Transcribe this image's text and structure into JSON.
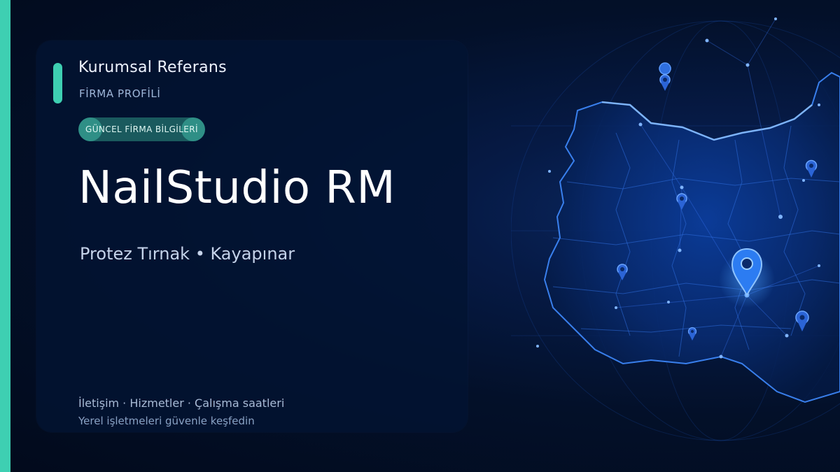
{
  "header": {
    "kicker": "Kurumsal Referans",
    "subkicker": "FİRMA PROFİLİ",
    "badge": "GÜNCEL FİRMA BİLGİLERİ"
  },
  "business": {
    "name": "NailStudio RM",
    "subtitle": "Protez Tırnak • Kayapınar"
  },
  "footer": {
    "links": "İletişim · Hizmetler · Çalışma saatleri",
    "tagline": "Yerel işletmeleri güvenle keşfedin"
  },
  "colors": {
    "accent": "#3ecfb2",
    "background": "#030d1f",
    "map_glow": "#1e6bff"
  },
  "icons": {
    "map_pin": "map-pin-icon"
  }
}
